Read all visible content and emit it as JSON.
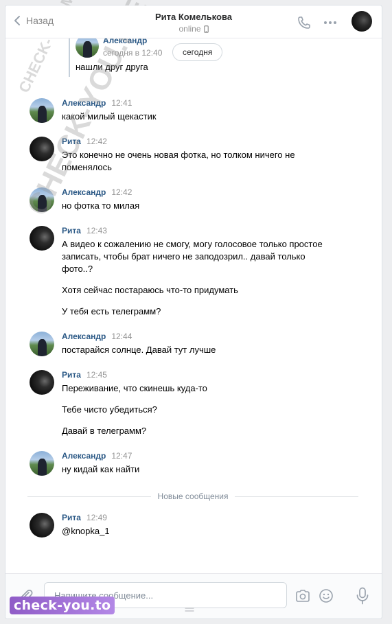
{
  "header": {
    "back_label": "Назад",
    "peer_name": "Рита Комелькова",
    "peer_status": "online"
  },
  "forwarded": {
    "author": "Александр",
    "time": "сегодня в 12:40",
    "text": "нашли друг друга"
  },
  "date_badge": "сегодня",
  "messages": [
    {
      "author": "Александр",
      "time": "12:41",
      "lines": [
        "какой милый щекастик"
      ]
    },
    {
      "author": "Рита",
      "time": "12:42",
      "lines": [
        "Это конечно не очень новая фотка, но толком ничего не поменялось"
      ]
    },
    {
      "author": "Александр",
      "time": "12:42",
      "lines": [
        "но фотка то милая"
      ]
    },
    {
      "author": "Рита",
      "time": "12:43",
      "lines": [
        "А видео к сожалению не смогу, могу голосовое только простое записать, чтобы брат ничего не заподозрил.. давай только фото..?",
        "Хотя сейчас постараюсь что-то придумать",
        "У тебя есть телеграмм?"
      ]
    },
    {
      "author": "Александр",
      "time": "12:44",
      "lines": [
        "постарайся солнце. Давай тут лучше"
      ]
    },
    {
      "author": "Рита",
      "time": "12:45",
      "lines": [
        "Переживание, что скинешь куда-то",
        "Тебе чисто убедиться?",
        "Давай в телеграмм?"
      ]
    },
    {
      "author": "Александр",
      "time": "12:47",
      "lines": [
        "ну кидай как найти"
      ]
    },
    {
      "author": "Рита",
      "time": "12:49",
      "lines": [
        "@knopka_1"
      ]
    }
  ],
  "new_messages_label": "Новые сообщения",
  "composer": {
    "placeholder": "Напишите сообщение..."
  },
  "watermarks": {
    "small": "CHECK-YOU.ME",
    "large": "CHECK-YOU.ME",
    "logo": "check-you.to"
  }
}
